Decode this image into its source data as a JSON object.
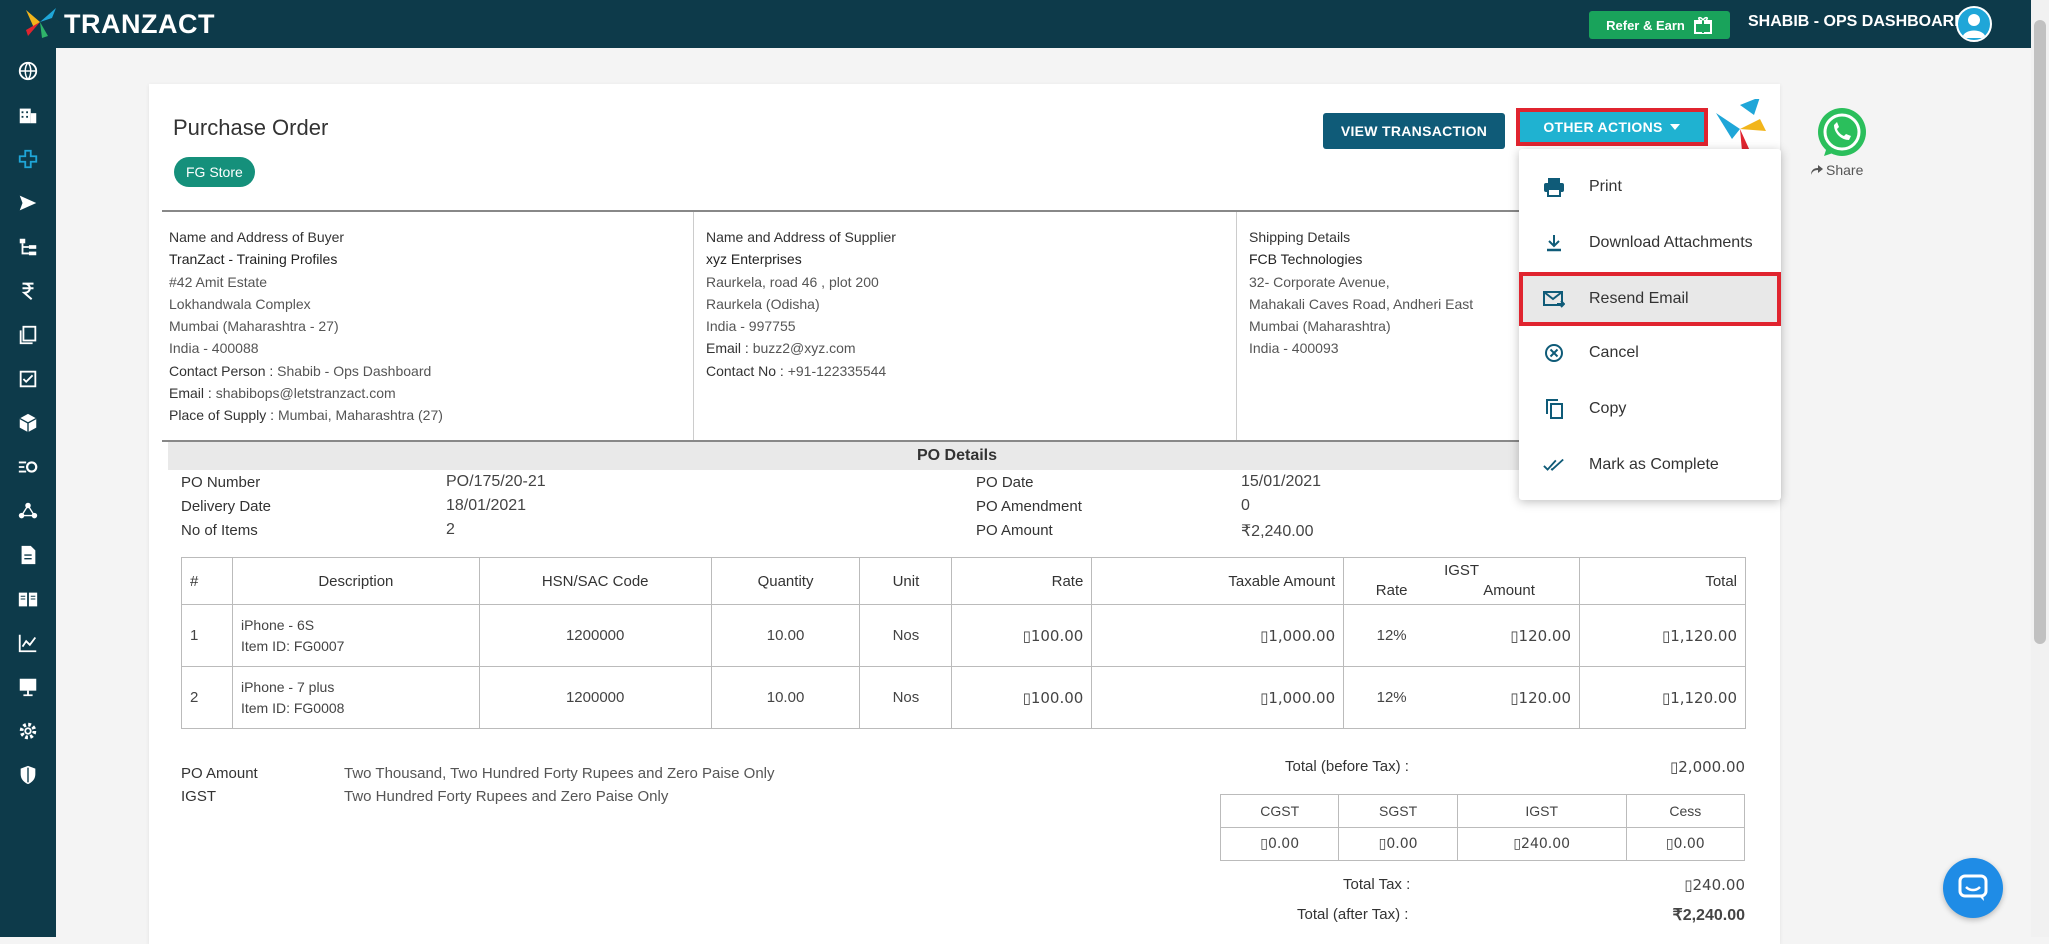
{
  "app": {
    "logo_text": "TRANZACT",
    "refer_label": "Refer & Earn",
    "user_label": "SHABIB - OPS DASHBOARD"
  },
  "sidebar": {
    "icons": [
      "globe-icon",
      "building-icon",
      "plus-cross-icon",
      "send-icon",
      "hierarchy-icon",
      "rupee-icon",
      "documents-icon",
      "checklist-icon",
      "box-icon",
      "workflow-icon",
      "network-icon",
      "file-icon",
      "book-icon",
      "chart-icon",
      "desktop-icon",
      "gear-icon",
      "shield-icon"
    ]
  },
  "header": {
    "title": "Purchase Order",
    "store_chip": "FG Store",
    "view_button": "VIEW TRANSACTION",
    "other_actions_button": "OTHER ACTIONS",
    "share_label": "Share"
  },
  "buyer": {
    "heading": "Name and Address of Buyer",
    "name": "TranZact - Training Profiles",
    "line1": "#42 Amit Estate",
    "line2": "Lokhandwala Complex",
    "line3": "Mumbai (Maharashtra - 27)",
    "line4": "India - 400088",
    "contact_label": "Contact Person :",
    "contact_value": "Shabib - Ops Dashboard",
    "email_label": "Email :",
    "email_value": "shabibops@letstranzact.com",
    "supply_label": "Place of Supply :",
    "supply_value": "Mumbai, Maharashtra (27)"
  },
  "supplier": {
    "heading": "Name and Address of Supplier",
    "name": "xyz Enterprises",
    "line1": "Raurkela, road 46 , plot 200",
    "line2": "Raurkela (Odisha)",
    "line3": "India - 997755",
    "email_label": "Email :",
    "email_value": "buzz2@xyz.com",
    "contact_label": "Contact No :",
    "contact_value": "+91-122335544"
  },
  "shipping": {
    "heading": "Shipping Details",
    "name": "FCB Technologies",
    "line1": "32- Corporate Avenue,",
    "line2": "Mahakali Caves Road, Andheri East",
    "line3": "Mumbai (Maharashtra)",
    "line4": "India - 400093"
  },
  "po_details": {
    "band_title": "PO Details",
    "po_number_label": "PO Number",
    "po_number": "PO/175/20-21",
    "delivery_label": "Delivery Date",
    "delivery": "18/01/2021",
    "items_label": "No of Items",
    "items": "2",
    "po_date_label": "PO Date",
    "po_date": "15/01/2021",
    "amendment_label": "PO Amendment",
    "amendment": "0",
    "amount_label": "PO Amount",
    "amount": "₹2,240.00"
  },
  "items_table": {
    "headers": {
      "num": "#",
      "desc": "Description",
      "hsn": "HSN/SAC Code",
      "qty": "Quantity",
      "unit": "Unit",
      "rate": "Rate",
      "taxable": "Taxable Amount",
      "igst": "IGST",
      "igst_rate": "Rate",
      "igst_amount": "Amount",
      "total": "Total"
    },
    "rows": [
      {
        "num": "1",
        "desc": "iPhone - 6S",
        "item_id": "Item ID: FG0007",
        "hsn": "1200000",
        "qty": "10.00",
        "unit": "Nos",
        "rate": "▯100.00",
        "taxable": "▯1,000.00",
        "igst_rate": "12%",
        "igst_amount": "▯120.00",
        "total": "▯1,120.00"
      },
      {
        "num": "2",
        "desc": "iPhone - 7 plus",
        "item_id": "Item ID: FG0008",
        "hsn": "1200000",
        "qty": "10.00",
        "unit": "Nos",
        "rate": "▯100.00",
        "taxable": "▯1,000.00",
        "igst_rate": "12%",
        "igst_amount": "▯120.00",
        "total": "▯1,120.00"
      }
    ]
  },
  "amount_words": {
    "po_amount_label": "PO Amount",
    "po_amount_words": "Two Thousand, Two Hundred Forty Rupees and Zero Paise Only",
    "igst_label": "IGST",
    "igst_words": "Two Hundred Forty Rupees and Zero Paise Only"
  },
  "totals": {
    "before_tax_label": "Total (before Tax) :",
    "before_tax": "▯2,000.00",
    "tax_headers": [
      "CGST",
      "SGST",
      "IGST",
      "Cess"
    ],
    "tax_values": [
      "▯0.00",
      "▯0.00",
      "▯240.00",
      "▯0.00"
    ],
    "total_tax_label": "Total Tax :",
    "total_tax": "▯240.00",
    "after_tax_label": "Total (after Tax) :",
    "after_tax": "₹2,240.00"
  },
  "menu": {
    "items": [
      {
        "label": "Print",
        "icon": "printer-icon"
      },
      {
        "label": "Download Attachments",
        "icon": "download-icon"
      },
      {
        "label": "Resend Email",
        "icon": "email-forward-icon"
      },
      {
        "label": "Cancel",
        "icon": "cancel-circle-icon"
      },
      {
        "label": "Copy",
        "icon": "copy-icon"
      },
      {
        "label": "Mark as Complete",
        "icon": "double-check-icon"
      }
    ],
    "selected": "Resend Email"
  },
  "colors": {
    "topbar": "#0d3a4a",
    "refer_button": "#19a35b",
    "view_button": "#0f5b78",
    "other_actions": "#1fb2d1",
    "chip": "#15907b",
    "highlight": "#e0242f"
  }
}
